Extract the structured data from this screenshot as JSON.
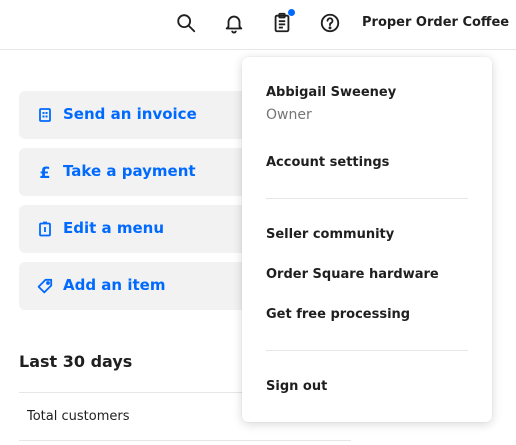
{
  "header": {
    "business_name": "Proper Order Coffee",
    "icons": [
      "search-icon",
      "bell-icon",
      "clipboard-icon",
      "help-icon"
    ],
    "notification_dot_color": "#006aff"
  },
  "actions": [
    {
      "label": "Send an invoice",
      "icon": "invoice-icon"
    },
    {
      "label": "Take a payment",
      "icon": "pound-icon"
    },
    {
      "label": "Edit a menu",
      "icon": "menu-icon"
    },
    {
      "label": "Add an item",
      "icon": "tag-icon"
    }
  ],
  "stats": {
    "title": "Last 30 days",
    "rows": [
      {
        "label": "Total customers"
      }
    ]
  },
  "account_menu": {
    "user_name": "Abbigail Sweeney",
    "role": "Owner",
    "account_settings": "Account settings",
    "seller_community": "Seller community",
    "order_hardware": "Order Square hardware",
    "free_processing": "Get free processing",
    "sign_out": "Sign out"
  },
  "colors": {
    "accent": "#006aff",
    "action_bg": "#f2f2f2",
    "text": "#1f1f1f",
    "muted": "#757575"
  }
}
